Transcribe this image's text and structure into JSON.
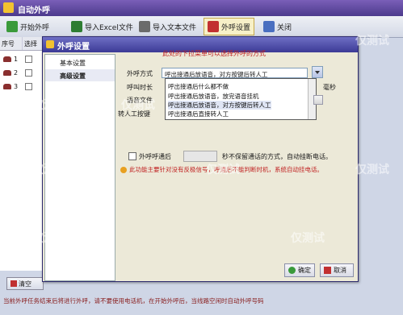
{
  "window": {
    "title": "自动外呼"
  },
  "toolbar": {
    "items": [
      {
        "label": "开始外呼",
        "icon": "play-icon"
      },
      {
        "label": "导入Excel文件",
        "icon": "excel-icon"
      },
      {
        "label": "导入文本文件",
        "icon": "text-file-icon"
      },
      {
        "label": "外呼设置",
        "icon": "settings-icon",
        "active": true
      },
      {
        "label": "关闭",
        "icon": "close-icon"
      }
    ]
  },
  "table": {
    "headers": [
      "序号",
      "选择"
    ],
    "rows": [
      {
        "no": "1"
      },
      {
        "no": "2"
      },
      {
        "no": "3"
      }
    ]
  },
  "bottom": {
    "clear_label": "清空",
    "status_text": "当前外呼任务结束后将进行外呼，请不要使用电话机，在开始外呼后，当线路空闲时自动外呼号码"
  },
  "dialog": {
    "title": "外呼设置",
    "sidebar": [
      {
        "label": "基本设置",
        "selected": false
      },
      {
        "label": "高级设置",
        "selected": true
      }
    ],
    "hint": "此处的下拉菜单可以选择外呼的方式",
    "labels": {
      "mode": "外呼方式",
      "duration": "呼叫时长",
      "voice_file": "语音文件",
      "transfer_key": "转人工按键"
    },
    "mode_value": "呼出接通后放语音，对方按键后转人工",
    "options": [
      "呼出接通后什么都不做",
      "呼出接通后放语音，放完语音挂机",
      "呼出接通后放语音，对方按键后转人工",
      "呼出接通后直接转人工"
    ],
    "selected_option_index": 2,
    "ms_label": "毫秒",
    "limit": {
      "checkbox_label": "外呼呼通后",
      "suffix": "秒不保留通话的方式，自动挂断电话。"
    },
    "warning": "此功能主要针对没有反极信号，呼通后不能判断时机，系统自动挂电话。",
    "ok_label": "确定",
    "cancel_label": "取消"
  },
  "watermark": "仅测试"
}
